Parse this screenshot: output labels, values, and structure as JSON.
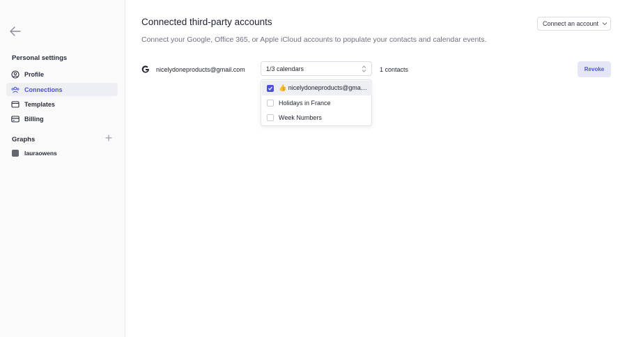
{
  "sidebar": {
    "back_icon": "arrow-left-icon",
    "personal_settings_title": "Personal settings",
    "items": [
      {
        "label": "Profile",
        "icon": "user-circle-icon",
        "active": false
      },
      {
        "label": "Connections",
        "icon": "users-icon",
        "active": true
      },
      {
        "label": "Templates",
        "icon": "window-icon",
        "active": false
      },
      {
        "label": "Billing",
        "icon": "credit-card-icon",
        "active": false
      }
    ],
    "graphs_title": "Graphs",
    "graph_items": [
      {
        "label": "lauraowens",
        "color": "#65676e"
      }
    ]
  },
  "main": {
    "title": "Connected third-party accounts",
    "description": "Connect your Google, Office 365, or Apple iCloud accounts to populate your contacts and calendar events.",
    "connect_button": "Connect an account",
    "account": {
      "provider_icon": "google-icon",
      "email": "nicelydoneproducts@gmail.com",
      "calendars_selected": "1/3 calendars",
      "contacts": "1 contacts",
      "revoke_label": "Revoke"
    },
    "calendar_options": [
      {
        "label": "👍 nicelydoneproducts@gmail.com",
        "checked": true
      },
      {
        "label": "Holidays in France",
        "checked": false
      },
      {
        "label": "Week Numbers",
        "checked": false
      }
    ]
  },
  "colors": {
    "accent": "#4a50d6",
    "sidebar_bg": "#fafafb",
    "active_bg": "#eeeff3"
  }
}
